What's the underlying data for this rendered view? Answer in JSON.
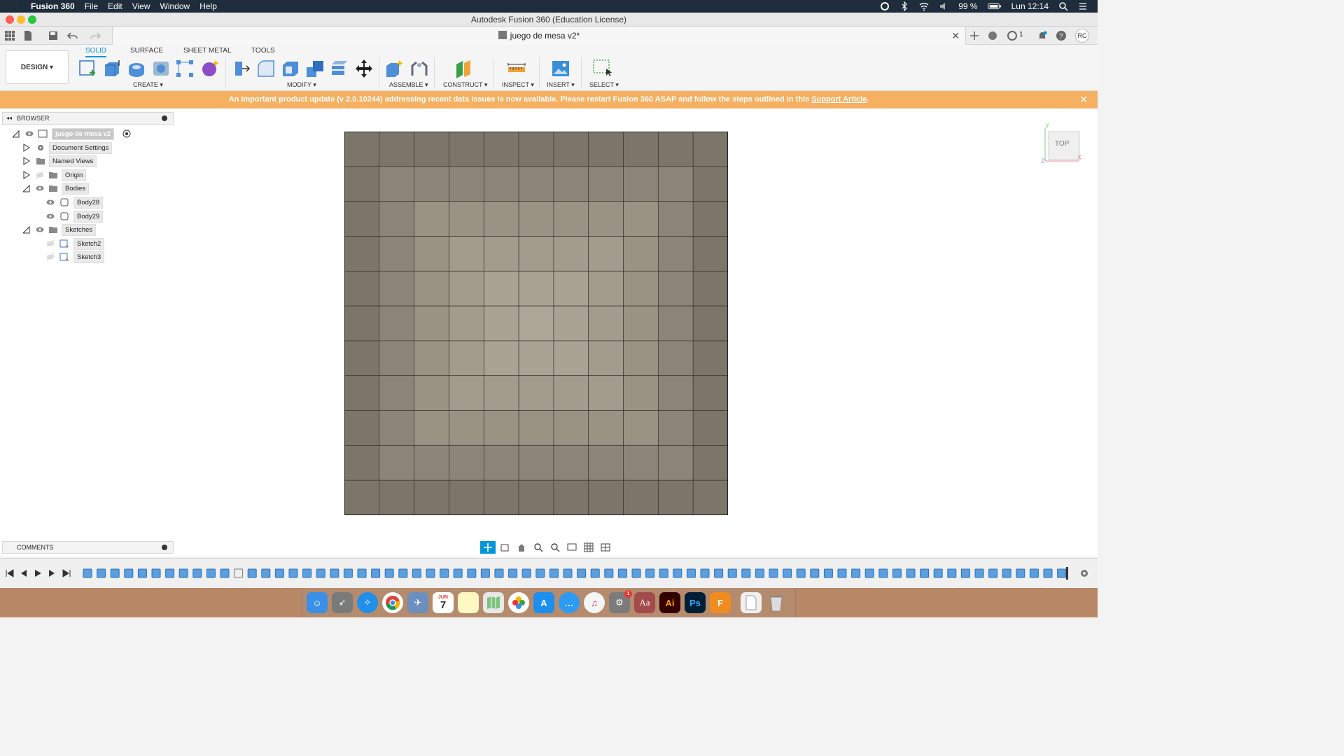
{
  "menubar": {
    "app_name": "Fusion 360",
    "items": [
      "File",
      "Edit",
      "View",
      "Window",
      "Help"
    ],
    "battery": "99 %",
    "clock": "Lun 12:14"
  },
  "window": {
    "title": "Autodesk Fusion 360 (Education License)"
  },
  "tabbar": {
    "document_title": "juego de mesa v2*",
    "job_count": "1",
    "user_initials": "RC"
  },
  "toolbar": {
    "workspace": "DESIGN",
    "tabs": [
      "SOLID",
      "SURFACE",
      "SHEET METAL",
      "TOOLS"
    ],
    "groups": [
      "CREATE",
      "MODIFY",
      "ASSEMBLE",
      "CONSTRUCT",
      "INSPECT",
      "INSERT",
      "SELECT"
    ]
  },
  "banner": {
    "message": "An important product update (v 2.0.10244) addressing recent data issues is now available. Please restart Fusion 360 ASAP and follow the steps outlined in this",
    "link_text": "Support Article",
    "trailing": "."
  },
  "browser": {
    "title": "BROWSER",
    "root": "juego de mesa v2",
    "nodes": [
      "Document Settings",
      "Named Views",
      "Origin",
      "Bodies",
      "Body28",
      "Body29",
      "Sketches",
      "Sketch2",
      "Sketch3"
    ]
  },
  "comments": {
    "title": "COMMENTS"
  },
  "viewcube": {
    "face": "TOP",
    "axis_y": "Y",
    "axis_x": "X",
    "axis_z": "Z"
  },
  "dock": {
    "calendar_month": "JUN",
    "calendar_day": "7",
    "notification_badge": "1"
  },
  "colors": {
    "accent": "#0696d7",
    "banner": "#f6b062",
    "menubar": "#1f2c3c",
    "model_tile": "#a09788"
  },
  "model": {
    "grid_columns": 11,
    "grid_rows": 11
  }
}
